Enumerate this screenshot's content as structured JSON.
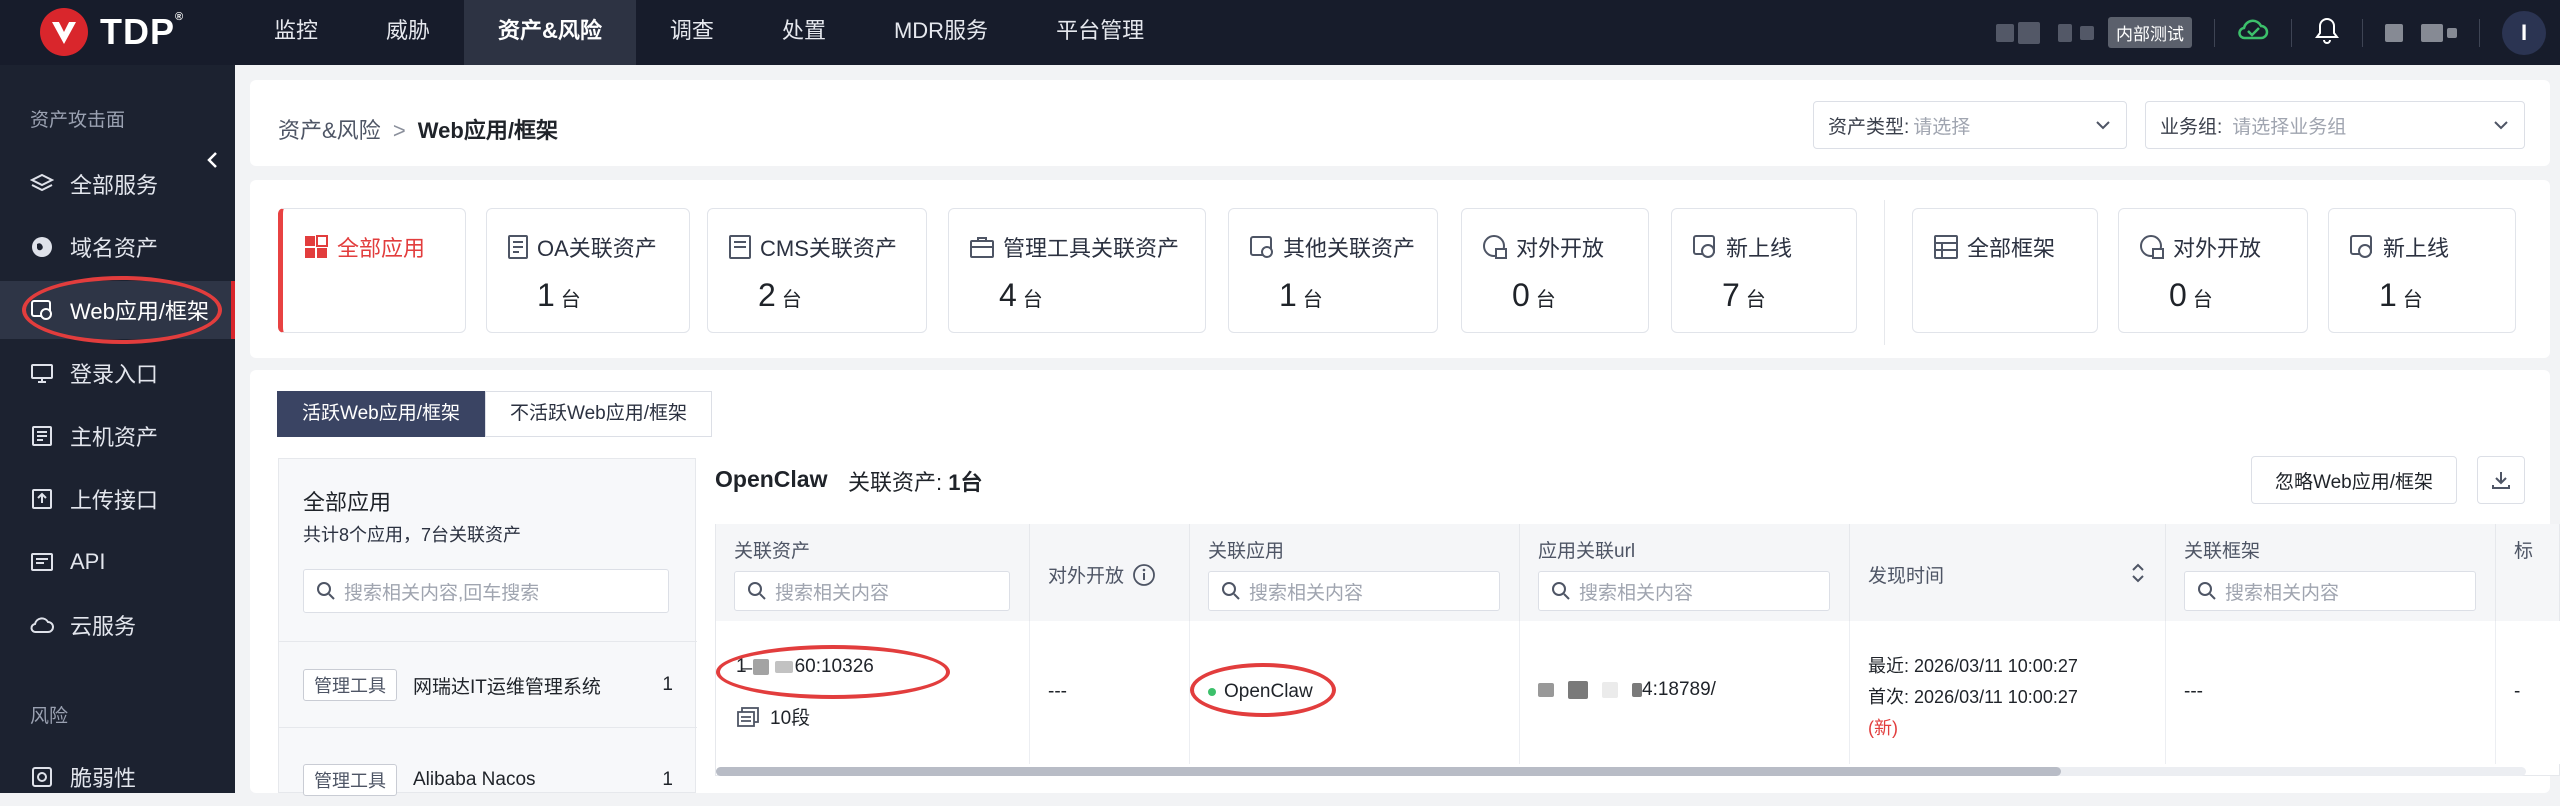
{
  "brand": {
    "name": "TDP",
    "reg": "®"
  },
  "nav": [
    "监控",
    "威胁",
    "资产&风险",
    "调查",
    "处置",
    "MDR服务",
    "平台管理"
  ],
  "header": {
    "user_badge": "内部测试",
    "avatar": "I"
  },
  "sidebar": {
    "section1": "资产攻击面",
    "items": [
      "全部服务",
      "域名资产",
      "Web应用/框架",
      "登录入口",
      "主机资产",
      "上传接口",
      "API",
      "云服务"
    ],
    "section2": "风险",
    "items2": [
      "脆弱性"
    ]
  },
  "breadcrumb": {
    "parent": "资产&风险",
    "sep": ">",
    "current": "Web应用/框架"
  },
  "filters": {
    "asset_type": {
      "label": "资产类型:",
      "placeholder": "请选择"
    },
    "group": {
      "label": "业务组:",
      "placeholder": "请选择业务组"
    }
  },
  "stats": [
    {
      "label": "全部应用",
      "value": ""
    },
    {
      "label": "OA关联资产",
      "value": "1",
      "unit": "台"
    },
    {
      "label": "CMS关联资产",
      "value": "2",
      "unit": "台"
    },
    {
      "label": "管理工具关联资产",
      "value": "4",
      "unit": "台"
    },
    {
      "label": "其他关联资产",
      "value": "1",
      "unit": "台"
    },
    {
      "label": "对外开放",
      "value": "0",
      "unit": "台"
    },
    {
      "label": "新上线",
      "value": "7",
      "unit": "台"
    }
  ],
  "stats2": [
    {
      "label": "全部框架",
      "value": ""
    },
    {
      "label": "对外开放",
      "value": "0",
      "unit": "台"
    },
    {
      "label": "新上线",
      "value": "1",
      "unit": "台"
    }
  ],
  "tabs": [
    "活跃Web应用/框架",
    "不活跃Web应用/框架"
  ],
  "left": {
    "title": "全部应用",
    "summary": "共计8个应用，7台关联资产",
    "search_ph": "搜索相关内容,回车搜索",
    "list": [
      {
        "tag": "管理工具",
        "name": "网瑞达IT运维管理系统",
        "count": "1"
      },
      {
        "tag": "管理工具",
        "name": "Alibaba Nacos",
        "count": "1"
      }
    ]
  },
  "detail": {
    "app": "OpenClaw",
    "assets_label": "关联资产:",
    "assets_value": "1台",
    "ignore_btn": "忽略Web应用/框架"
  },
  "table": {
    "columns": [
      "关联资产",
      "对外开放",
      "关联应用",
      "应用关联url",
      "发现时间",
      "关联框架",
      "标"
    ],
    "search_ph": "搜索相关内容",
    "row": {
      "asset_prefix": "1̶",
      "asset_suffix": "60:10326",
      "segment": "10段",
      "open": "---",
      "app": "OpenClaw",
      "url_suffix": "4:18789/",
      "latest_label": "最近:",
      "latest": "2026/03/11 10:00:27",
      "first_label": "首次:",
      "first": "2026/03/11 10:00:27",
      "new": "(新)",
      "framework": "---",
      "tail": "-"
    }
  }
}
